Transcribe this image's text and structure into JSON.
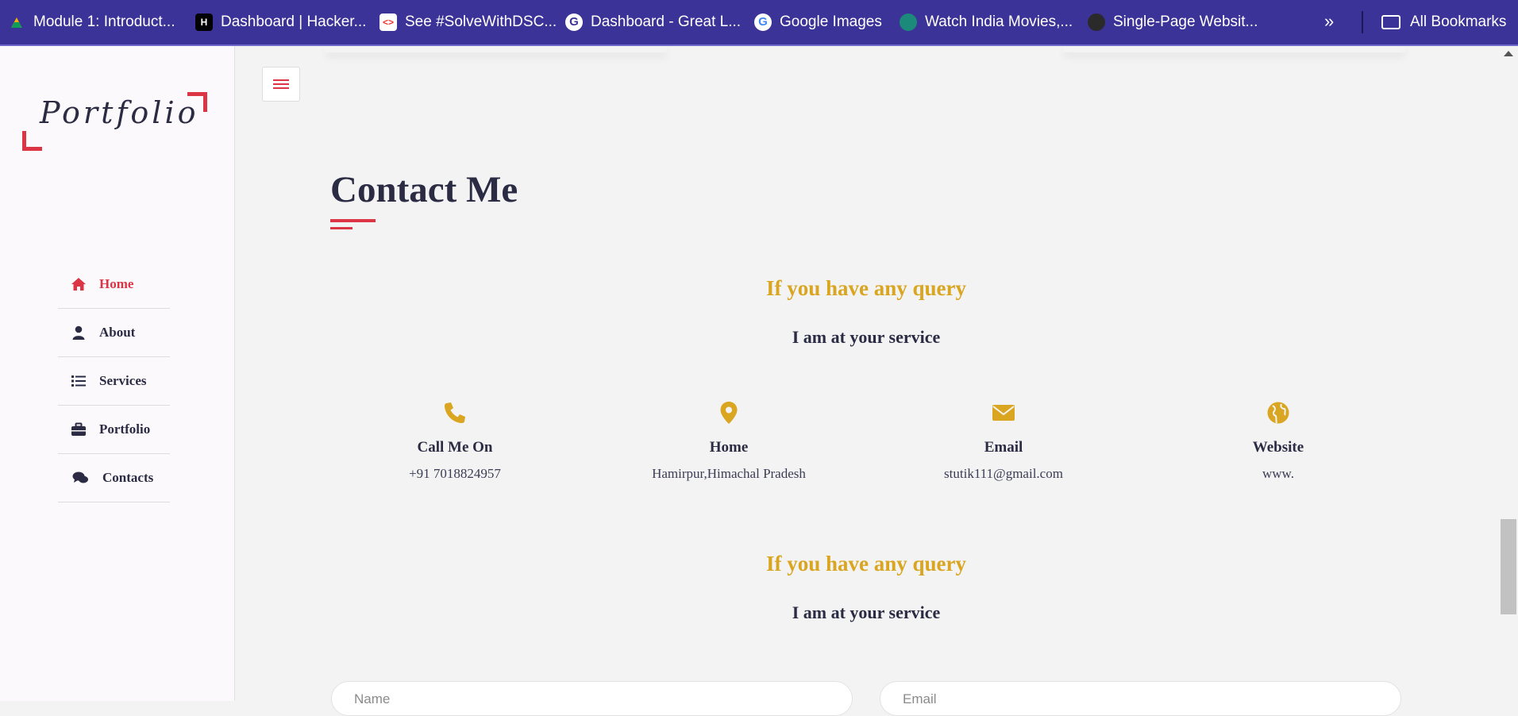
{
  "bookmarks": {
    "items": [
      {
        "label": "Module 1: Introduct...",
        "icon": "drive-icon"
      },
      {
        "label": "Dashboard | Hacker...",
        "icon": "hackerrank-icon"
      },
      {
        "label": "See #SolveWithDSC...",
        "icon": "code-icon"
      },
      {
        "label": "Dashboard - Great L...",
        "icon": "g-icon"
      },
      {
        "label": "Google Images",
        "icon": "google-icon"
      },
      {
        "label": "Watch India Movies,...",
        "icon": "film-reel-icon"
      },
      {
        "label": "Single-Page Websit...",
        "icon": "site-icon"
      }
    ],
    "more": "»",
    "all_bookmarks": "All Bookmarks"
  },
  "sidebar": {
    "logo": "Portfolio",
    "items": [
      {
        "label": "Home",
        "icon": "home-icon"
      },
      {
        "label": "About",
        "icon": "user-icon"
      },
      {
        "label": "Services",
        "icon": "list-icon"
      },
      {
        "label": "Portfolio",
        "icon": "briefcase-icon"
      },
      {
        "label": "Contacts",
        "icon": "chat-icon"
      }
    ]
  },
  "main": {
    "title": "Contact Me",
    "query_heading": "If you have any query",
    "service_heading": "I am at your service",
    "query_heading_2": "If you have any query",
    "service_heading_2": "I am at your service",
    "info": [
      {
        "title": "Call Me On",
        "value": "+91 7018824957",
        "icon": "phone-icon"
      },
      {
        "title": "Home",
        "value": "Hamirpur,Himachal Pradesh",
        "icon": "map-pin-icon"
      },
      {
        "title": "Email",
        "value": "stutik111@gmail.com",
        "icon": "envelope-icon"
      },
      {
        "title": "Website",
        "value": "www.",
        "icon": "globe-icon"
      }
    ],
    "form": {
      "name_placeholder": "Name",
      "email_placeholder": "Email"
    }
  },
  "colors": {
    "accent": "#dc3545",
    "gold": "#daa520",
    "bookmark_bar": "#3b3397",
    "text": "#2b2c44"
  }
}
